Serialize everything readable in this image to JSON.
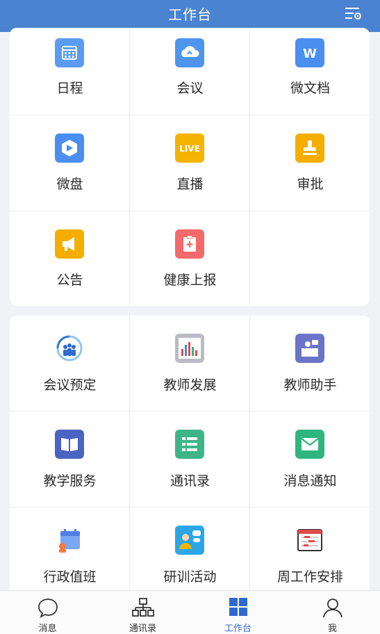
{
  "header": {
    "title": "工作台"
  },
  "section1": [
    {
      "label": "日程",
      "icon": "calendar-icon",
      "color": "#5a9cf0"
    },
    {
      "label": "会议",
      "icon": "cloud-icon",
      "color": "#4f95ee"
    },
    {
      "label": "微文档",
      "icon": "word-doc-icon",
      "color": "#4a8ff0",
      "glyph": "W"
    },
    {
      "label": "微盘",
      "icon": "disk-icon",
      "color": "#4a8ff0"
    },
    {
      "label": "直播",
      "icon": "live-icon",
      "color": "#f5b400",
      "glyph": "LIVE"
    },
    {
      "label": "审批",
      "icon": "stamp-icon",
      "color": "#f5ad00"
    },
    {
      "label": "公告",
      "icon": "megaphone-icon",
      "color": "#f5ad00"
    },
    {
      "label": "健康上报",
      "icon": "health-report-icon",
      "color": "#f46a6a"
    }
  ],
  "section2": [
    {
      "label": "会议预定",
      "icon": "meeting-booking-icon"
    },
    {
      "label": "教师发展",
      "icon": "bar-chart-icon"
    },
    {
      "label": "教师助手",
      "icon": "teacher-assistant-icon",
      "color": "#6b74c9"
    },
    {
      "label": "教学服务",
      "icon": "book-icon",
      "color": "#4a64c2"
    },
    {
      "label": "通讯录",
      "icon": "list-icon",
      "color": "#3eb589"
    },
    {
      "label": "消息通知",
      "icon": "mail-icon",
      "color": "#2fb57f"
    },
    {
      "label": "行政值班",
      "icon": "duty-calendar-icon"
    },
    {
      "label": "研训活动",
      "icon": "training-activity-icon"
    },
    {
      "label": "周工作安排",
      "icon": "weekly-schedule-icon"
    }
  ],
  "tabbar": {
    "items": [
      {
        "label": "消息",
        "icon": "chat-bubble-icon"
      },
      {
        "label": "通讯录",
        "icon": "org-chart-icon"
      },
      {
        "label": "工作台",
        "icon": "grid-icon"
      },
      {
        "label": "我",
        "icon": "person-icon"
      }
    ],
    "active_color": "#2f6ad1"
  }
}
